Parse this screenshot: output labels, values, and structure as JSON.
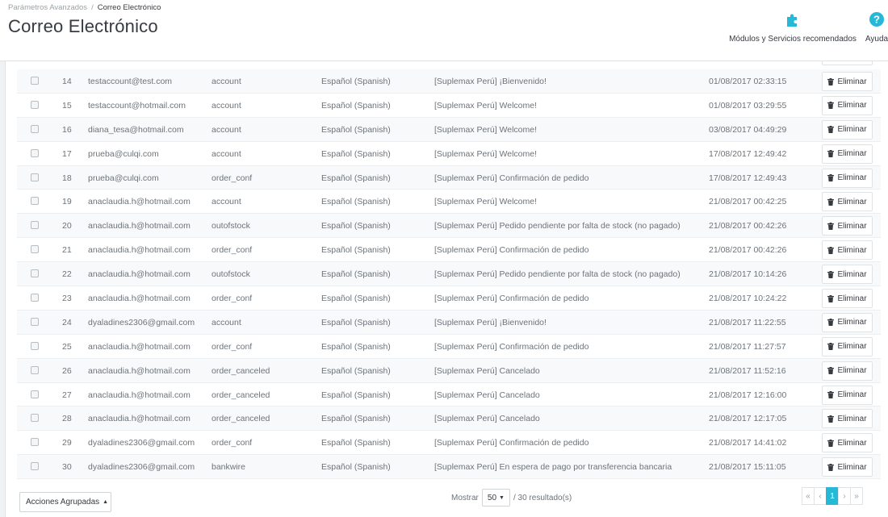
{
  "breadcrumb": {
    "parent": "Parámetros Avanzados",
    "separator": "/",
    "current": "Correo Electrónico"
  },
  "page_title": "Correo Electrónico",
  "toolbar": {
    "modules_label": "Módulos y Servicios recomendados",
    "modules_icon": "puzzle-icon",
    "help_label": "Ayuda",
    "help_icon": "help-circle-icon",
    "accent": "#25b9d7"
  },
  "table": {
    "delete_label": "Eliminar",
    "rows": [
      {
        "id": "14",
        "email": "testaccount@test.com",
        "template": "account",
        "language": "Español (Spanish)",
        "subject": "[Suplemax Perú] ¡Bienvenido!",
        "date": "01/08/2017 02:33:15"
      },
      {
        "id": "15",
        "email": "testaccount@hotmail.com",
        "template": "account",
        "language": "Español (Spanish)",
        "subject": "[Suplemax Perú] Welcome!",
        "date": "01/08/2017 03:29:55"
      },
      {
        "id": "16",
        "email": "diana_tesa@hotmail.com",
        "template": "account",
        "language": "Español (Spanish)",
        "subject": "[Suplemax Perú] Welcome!",
        "date": "03/08/2017 04:49:29"
      },
      {
        "id": "17",
        "email": "prueba@culqi.com",
        "template": "account",
        "language": "Español (Spanish)",
        "subject": "[Suplemax Perú] Welcome!",
        "date": "17/08/2017 12:49:42"
      },
      {
        "id": "18",
        "email": "prueba@culqi.com",
        "template": "order_conf",
        "language": "Español (Spanish)",
        "subject": "[Suplemax Perú] Confirmación de pedido",
        "date": "17/08/2017 12:49:43"
      },
      {
        "id": "19",
        "email": "anaclaudia.h@hotmail.com",
        "template": "account",
        "language": "Español (Spanish)",
        "subject": "[Suplemax Perú] Welcome!",
        "date": "21/08/2017 00:42:25"
      },
      {
        "id": "20",
        "email": "anaclaudia.h@hotmail.com",
        "template": "outofstock",
        "language": "Español (Spanish)",
        "subject": "[Suplemax Perú] Pedido pendiente por falta de stock (no pagado)",
        "date": "21/08/2017 00:42:26"
      },
      {
        "id": "21",
        "email": "anaclaudia.h@hotmail.com",
        "template": "order_conf",
        "language": "Español (Spanish)",
        "subject": "[Suplemax Perú] Confirmación de pedido",
        "date": "21/08/2017 00:42:26"
      },
      {
        "id": "22",
        "email": "anaclaudia.h@hotmail.com",
        "template": "outofstock",
        "language": "Español (Spanish)",
        "subject": "[Suplemax Perú] Pedido pendiente por falta de stock (no pagado)",
        "date": "21/08/2017 10:14:26"
      },
      {
        "id": "23",
        "email": "anaclaudia.h@hotmail.com",
        "template": "order_conf",
        "language": "Español (Spanish)",
        "subject": "[Suplemax Perú] Confirmación de pedido",
        "date": "21/08/2017 10:24:22"
      },
      {
        "id": "24",
        "email": "dyaladines2306@gmail.com",
        "template": "account",
        "language": "Español (Spanish)",
        "subject": "[Suplemax Perú] ¡Bienvenido!",
        "date": "21/08/2017 11:22:55"
      },
      {
        "id": "25",
        "email": "anaclaudia.h@hotmail.com",
        "template": "order_conf",
        "language": "Español (Spanish)",
        "subject": "[Suplemax Perú] Confirmación de pedido",
        "date": "21/08/2017 11:27:57"
      },
      {
        "id": "26",
        "email": "anaclaudia.h@hotmail.com",
        "template": "order_canceled",
        "language": "Español (Spanish)",
        "subject": "[Suplemax Perú] Cancelado",
        "date": "21/08/2017 11:52:16"
      },
      {
        "id": "27",
        "email": "anaclaudia.h@hotmail.com",
        "template": "order_canceled",
        "language": "Español (Spanish)",
        "subject": "[Suplemax Perú] Cancelado",
        "date": "21/08/2017 12:16:00"
      },
      {
        "id": "28",
        "email": "anaclaudia.h@hotmail.com",
        "template": "order_canceled",
        "language": "Español (Spanish)",
        "subject": "[Suplemax Perú] Cancelado",
        "date": "21/08/2017 12:17:05"
      },
      {
        "id": "29",
        "email": "dyaladines2306@gmail.com",
        "template": "order_conf",
        "language": "Español (Spanish)",
        "subject": "[Suplemax Perú] Confirmación de pedido",
        "date": "21/08/2017 14:41:02"
      },
      {
        "id": "30",
        "email": "dyaladines2306@gmail.com",
        "template": "bankwire",
        "language": "Español (Spanish)",
        "subject": "[Suplemax Perú] En espera de pago por transferencia bancaria",
        "date": "21/08/2017 15:11:05"
      }
    ]
  },
  "footer": {
    "bulk_actions_label": "Acciones Agrupadas",
    "show_label": "Mostrar",
    "per_page": "50",
    "results_label": "/ 30 resultado(s)",
    "pagination": {
      "first": "«",
      "prev": "‹",
      "current": "1",
      "next": "›",
      "last": "»"
    }
  }
}
